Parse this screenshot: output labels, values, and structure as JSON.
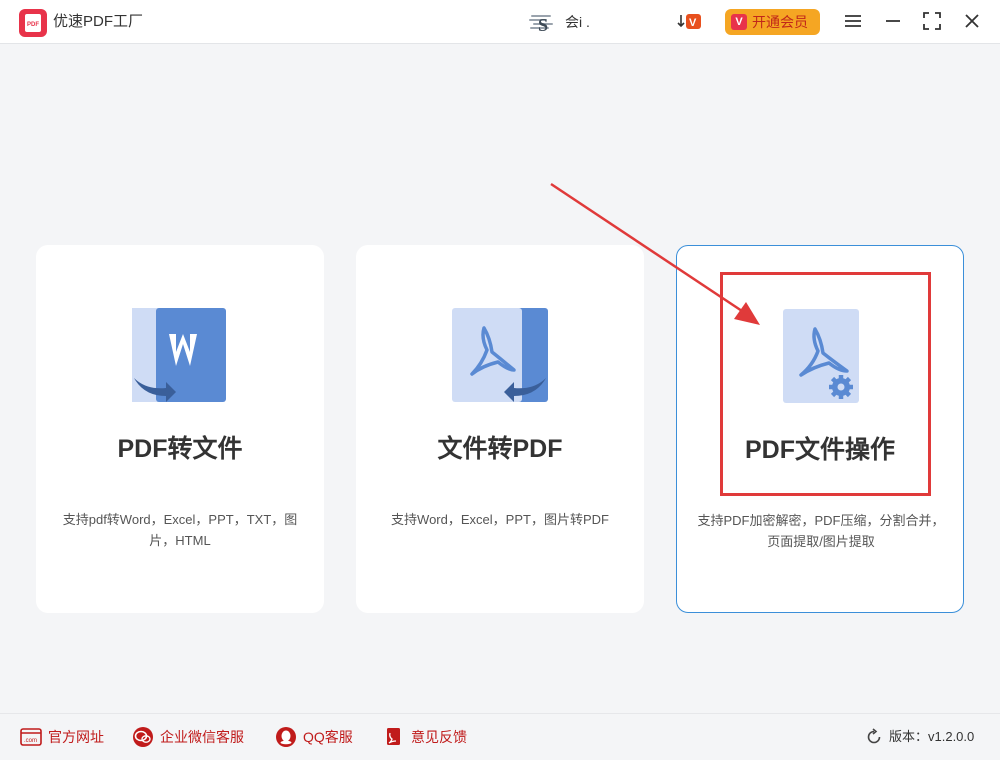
{
  "app": {
    "title": "优速PDF工厂",
    "logo_text": "PDF"
  },
  "header": {
    "user_name": "会i .",
    "vip_button_label": "开通会员",
    "vip_badge_text": "V"
  },
  "cards": [
    {
      "title": "PDF转文件",
      "description": "支持pdf转Word，Excel，PPT，TXT，图片，HTML",
      "icon": "pdf-to-word-icon"
    },
    {
      "title": "文件转PDF",
      "description": "支持Word，Excel，PPT，图片转PDF",
      "icon": "file-to-pdf-icon"
    },
    {
      "title": "PDF文件操作",
      "description": "支持PDF加密解密，PDF压缩，分割合并，页面提取/图片提取",
      "icon": "pdf-settings-icon"
    }
  ],
  "footer": {
    "links": [
      {
        "label": "官方网址",
        "icon": "website-icon"
      },
      {
        "label": "企业微信客服",
        "icon": "wechat-icon"
      },
      {
        "label": "QQ客服",
        "icon": "qq-icon"
      },
      {
        "label": "意见反馈",
        "icon": "feedback-icon"
      }
    ],
    "version": "版本：v1.2.0.0"
  },
  "colors": {
    "accent": "#3b8fd9",
    "brand": "#e8334a",
    "vip": "#f5a623",
    "icon_blue": "#5a8ad3",
    "icon_light": "#cfdcf5",
    "annotation_red": "#e03a3a"
  }
}
